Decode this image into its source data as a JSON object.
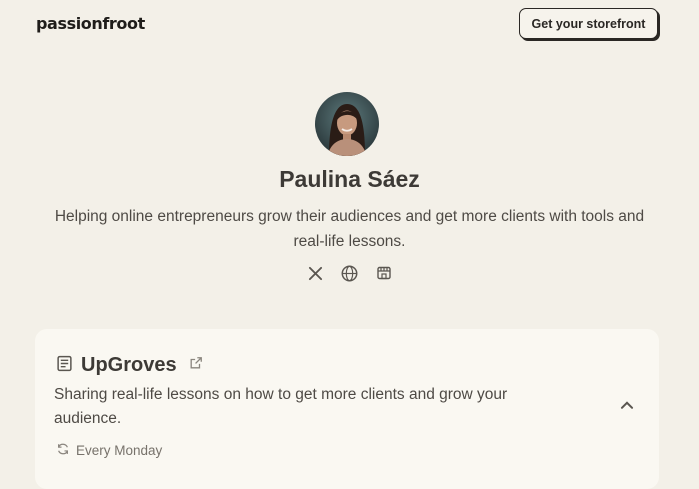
{
  "header": {
    "logo_text": "passionfroot",
    "cta_label": "Get your storefront"
  },
  "profile": {
    "name": "Paulina Sáez",
    "bio": "Helping online entrepreneurs grow their audiences and get more clients with tools and real-life lessons.",
    "socials": [
      "x-icon",
      "website-icon",
      "storefront-icon"
    ]
  },
  "newsletter": {
    "title": "UpGroves",
    "description": "Sharing real-life lessons on how to get more clients and grow your audience.",
    "frequency": "Every Monday",
    "expanded": true
  },
  "colors": {
    "background": "#f3f0e8",
    "card": "#faf8f2",
    "text": "#3d3a36"
  }
}
